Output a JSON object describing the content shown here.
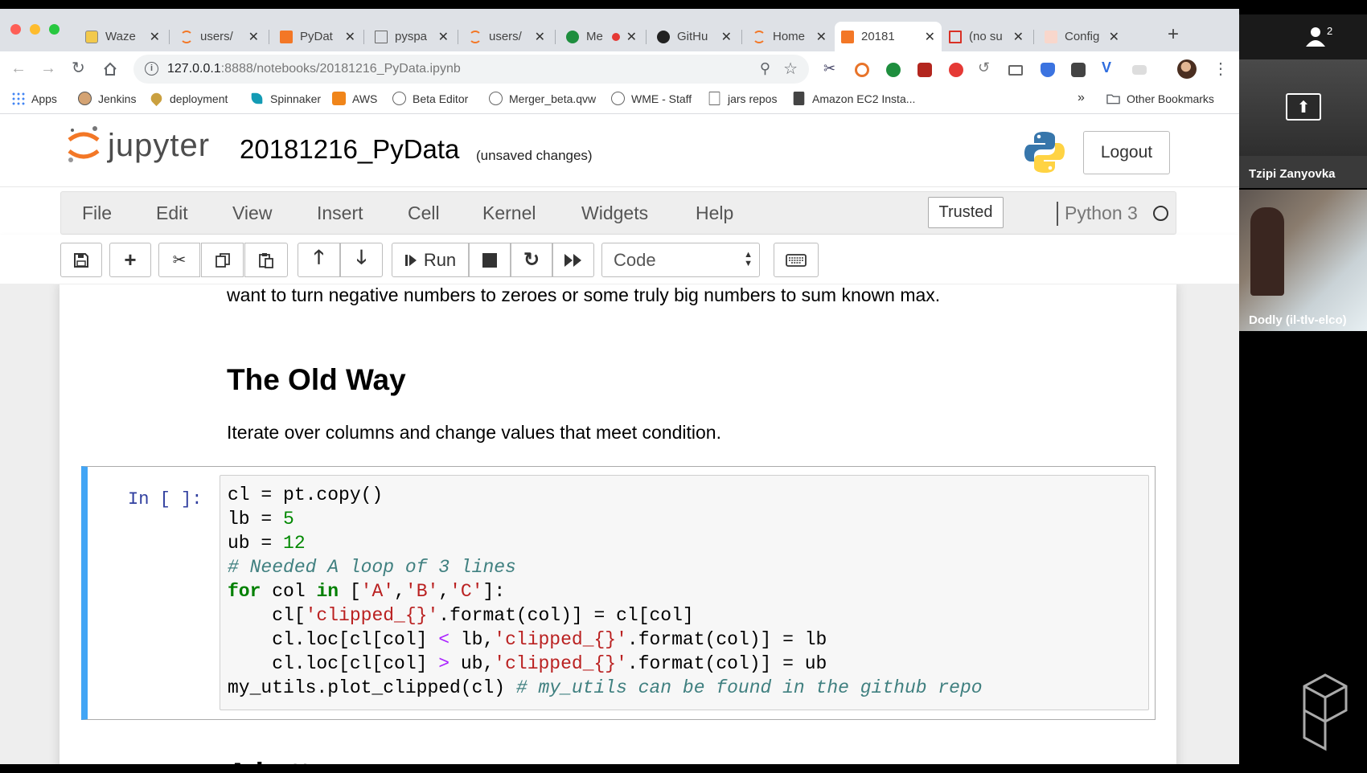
{
  "browser": {
    "tabs": [
      {
        "label": "Waze",
        "icon": "waze-icon",
        "active": false
      },
      {
        "label": "users/",
        "icon": "jupyter-tab-icon",
        "active": false
      },
      {
        "label": "PyDat",
        "icon": "notebook-tab-icon",
        "active": false
      },
      {
        "label": "pyspa",
        "icon": "file-tab-icon",
        "active": false
      },
      {
        "label": "users/",
        "icon": "jupyter-tab-icon",
        "active": false
      },
      {
        "label": "Me",
        "icon": "meet-tab-icon",
        "active": false
      },
      {
        "label": "GitHu",
        "icon": "github-icon",
        "active": false
      },
      {
        "label": "Home",
        "icon": "jupyter-tab-icon",
        "active": false
      },
      {
        "label": "20181",
        "icon": "notebook-tab-icon",
        "active": true
      },
      {
        "label": "(no su",
        "icon": "gmail-icon",
        "active": false
      },
      {
        "label": "Config",
        "icon": "config-tab-icon",
        "active": false
      }
    ],
    "url_host": "127.0.0.1",
    "url_rest": ":8888/notebooks/20181216_PyData.ipynb",
    "bookmarks": [
      {
        "label": "Apps",
        "icon": "apps-grid-icon"
      },
      {
        "label": "Jenkins",
        "icon": "jenkins-icon"
      },
      {
        "label": "deployment",
        "icon": "location-icon"
      },
      {
        "label": "Spinnaker",
        "icon": "spinnaker-icon"
      },
      {
        "label": "AWS",
        "icon": "aws-icon"
      },
      {
        "label": "Beta Editor",
        "icon": "waze-icon"
      },
      {
        "label": "Merger_beta.qvw",
        "icon": "waze-icon"
      },
      {
        "label": "WME - Staff",
        "icon": "waze-icon"
      },
      {
        "label": "jars repos",
        "icon": "page-icon"
      },
      {
        "label": "Amazon EC2 Insta...",
        "icon": "ec2-icon"
      }
    ],
    "bookmarks_overflow": "»",
    "other_bookmarks": "Other Bookmarks"
  },
  "jupyter": {
    "logo_text": "jupyter",
    "notebook_name": "20181216_PyData",
    "save_status": "(unsaved changes)",
    "logout_label": "Logout",
    "menu": [
      "File",
      "Edit",
      "View",
      "Insert",
      "Cell",
      "Kernel",
      "Widgets",
      "Help"
    ],
    "trusted_label": "Trusted",
    "kernel_name": "Python 3",
    "run_label": "Run",
    "cell_type": "Code"
  },
  "notebook": {
    "md_text1": "want to turn negative numbers to zeroes or some truly big numbers to sum known max.",
    "md_heading": "The Old Way",
    "md_text2": "Iterate over columns and change values that meet condition.",
    "prompt": "In [ ]:",
    "md_heading2": "A better way"
  },
  "meeting": {
    "participant_count": "2",
    "participant1_name": "Tzipi Zanyovka",
    "participant2_name": "Dodly (il-tlv-elco)"
  }
}
